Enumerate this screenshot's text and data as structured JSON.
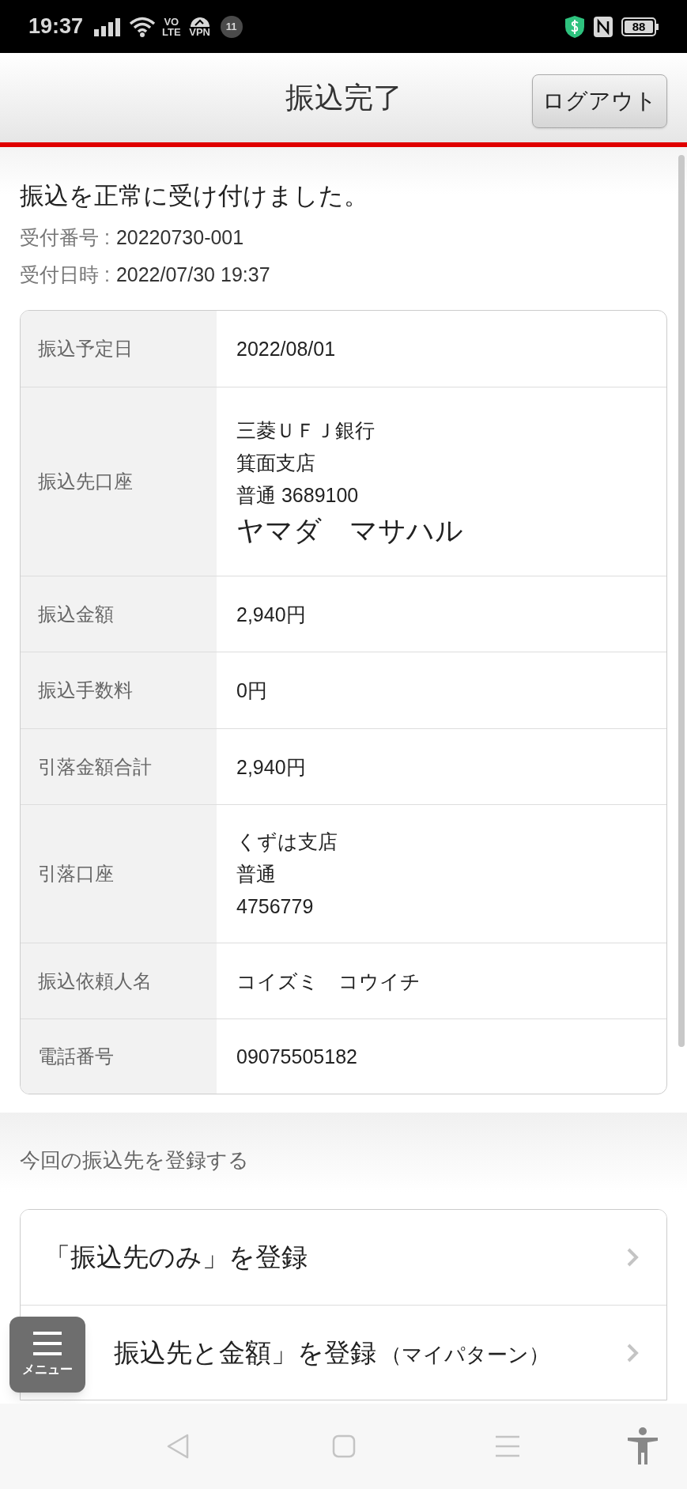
{
  "status_bar": {
    "time": "19:37",
    "volte_top": "VO",
    "volte_bottom": "LTE",
    "vpn": "VPN",
    "notification_count": "11",
    "battery": "88"
  },
  "header": {
    "title": "振込完了",
    "logout_button": "ログアウト"
  },
  "result": {
    "message": "振込を正常に受け付けました。",
    "receipt": [
      {
        "label": "受付番号 :",
        "value": "20220730-001"
      },
      {
        "label": "受付日時 :",
        "value": "2022/07/30 19:37"
      }
    ]
  },
  "details": [
    {
      "label": "振込予定日",
      "lines": [
        {
          "kind": "line",
          "text": "2022/08/01"
        }
      ]
    },
    {
      "label": "振込先口座",
      "lines": [
        {
          "kind": "line",
          "text": "三菱ＵＦＪ銀行"
        },
        {
          "kind": "line",
          "text": "箕面支店"
        },
        {
          "kind": "line",
          "text": "普通 3689100"
        },
        {
          "kind": "name",
          "text": "ヤマダ　マサハル"
        }
      ]
    },
    {
      "label": "振込金額",
      "lines": [
        {
          "kind": "line",
          "text": "2,940円"
        }
      ]
    },
    {
      "label": "振込手数料",
      "lines": [
        {
          "kind": "line",
          "text": "0円"
        }
      ]
    },
    {
      "label": "引落金額合計",
      "lines": [
        {
          "kind": "line",
          "text": "2,940円"
        }
      ]
    },
    {
      "label": "引落口座",
      "lines": [
        {
          "kind": "line",
          "text": "くずは支店"
        },
        {
          "kind": "line",
          "text": "普通"
        },
        {
          "kind": "line",
          "text": "4756779"
        }
      ]
    },
    {
      "label": "振込依頼人名",
      "lines": [
        {
          "kind": "line",
          "text": "コイズミ　コウイチ"
        }
      ]
    },
    {
      "label": "電話番号",
      "lines": [
        {
          "kind": "line",
          "text": "09075505182"
        }
      ]
    }
  ],
  "register": {
    "heading": "今回の振込先を登録する",
    "items": [
      {
        "label": "「振込先のみ」を登録"
      },
      {
        "label": "振込先と金額」を登録",
        "note": "（マイパターン）"
      }
    ]
  },
  "menu_button": {
    "label": "メニュー"
  }
}
